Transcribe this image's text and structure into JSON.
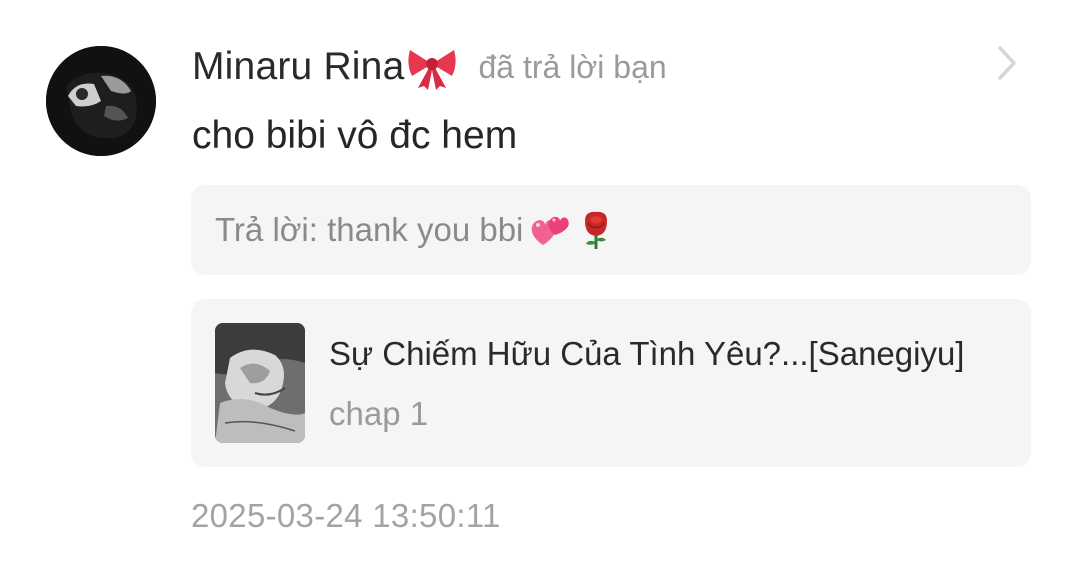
{
  "notification": {
    "username": "Minaru Rina",
    "username_emoji": "bow-icon",
    "action": "đã trả lời bạn",
    "message": "cho bibi vô đc hem",
    "quote": {
      "prefix": "Trả lời: thank you bbi",
      "emojis": [
        "hearts-icon",
        "rose-icon"
      ]
    },
    "story": {
      "title": "Sự Chiếm Hữu Của Tình Yêu?...[Sanegiyu]",
      "chapter": "chap 1"
    },
    "timestamp": "2025-03-24 13:50:11"
  },
  "colors": {
    "background": "#ffffff",
    "card_background": "#f5f5f6",
    "primary_text": "#262626",
    "secondary_text": "#9a9a9a",
    "bow": "#e8384f",
    "hearts": "#f06292",
    "rose": "#c62828"
  }
}
